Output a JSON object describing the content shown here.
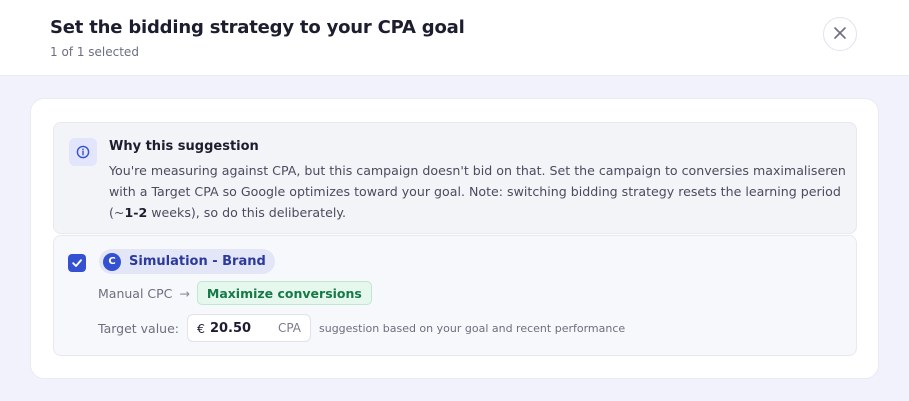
{
  "header": {
    "title": "Set the bidding strategy to your CPA goal",
    "subtitle": "1 of 1 selected",
    "close_icon": "close-icon"
  },
  "why": {
    "icon": "info-icon",
    "title": "Why this suggestion",
    "text_before": "You're measuring against CPA, but this campaign doesn't bid on that. Set the campaign to conversies maximaliseren with a Target CPA so Google optimizes toward your goal. Note: switching bidding strategy resets the learning period (~",
    "text_bold": "1-2",
    "text_after": " weeks), so do this deliberately."
  },
  "campaign": {
    "checked": true,
    "avatar_letter": "C",
    "name": "Simulation - Brand",
    "from_strategy": "Manual CPC",
    "arrow": "→",
    "to_strategy": "Maximize conversions",
    "target_label": "Target value:",
    "currency": "€",
    "amount": "20.50",
    "unit": "CPA",
    "hint": "suggestion based on your goal and recent performance"
  },
  "colors": {
    "accent": "#3451d1",
    "success_text": "#157a47",
    "success_bg": "#e6f7ee"
  }
}
